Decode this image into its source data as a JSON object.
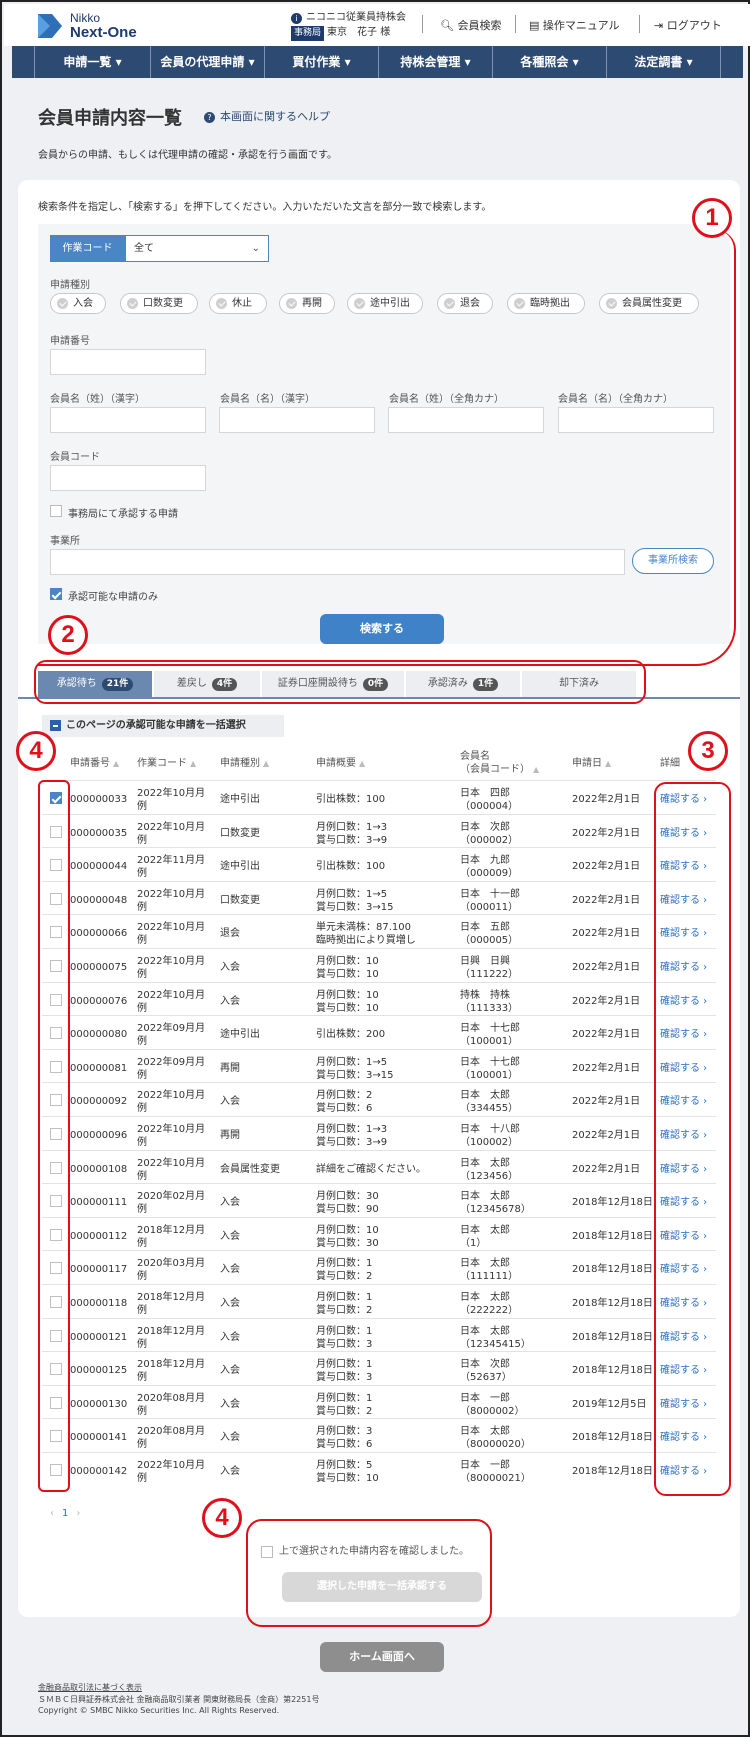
{
  "header": {
    "logo_line1": "Nikko",
    "logo_line2": "Next-One",
    "association": "ニコニコ従業員持株会",
    "role_badge": "事務局",
    "user_name": "東京　花子 様",
    "links": {
      "member_search": "会員検索",
      "manual": "操作マニュアル",
      "logout": "ログアウト"
    }
  },
  "nav": [
    "申請一覧 ▾",
    "会員の代理申請 ▾",
    "買付作業 ▾",
    "持株会管理 ▾",
    "各種照会 ▾",
    "法定調書 ▾"
  ],
  "page": {
    "title": "会員申請内容一覧",
    "help": "本画面に関するヘルプ",
    "description": "会員からの申請、もしくは代理申請の確認・承認を行う画面です。"
  },
  "search": {
    "instruction": "検索条件を指定し、「検索する」を押下してください。入力いただいた文言を部分一致で検索します。",
    "work_code_label": "作業コード",
    "work_code_value": "全て",
    "type_label": "申請種別",
    "types": [
      "入会",
      "口数変更",
      "休止",
      "再開",
      "途中引出",
      "退会",
      "臨時拠出",
      "会員属性変更"
    ],
    "app_no_label": "申請番号",
    "name_labels": [
      "会員名（姓）（漢字）",
      "会員名（名）（漢字）",
      "会員名（姓）（全角カナ）",
      "会員名（名）（全角カナ）"
    ],
    "member_code_label": "会員コード",
    "office_approve_label": "事務局にて承認する申請",
    "office_label": "事業所",
    "office_search_button": "事業所検索",
    "approvable_only_label": "承認可能な申請のみ",
    "search_button": "検索する"
  },
  "tabs": [
    {
      "label": "承認待ち",
      "count": "21件"
    },
    {
      "label": "差戻し",
      "count": "4件"
    },
    {
      "label": "証券口座開設待ち",
      "count": "0件"
    },
    {
      "label": "承認済み",
      "count": "1件"
    },
    {
      "label": "却下済み",
      "count": ""
    }
  ],
  "select_all": "このページの承認可能な申請を一括選択",
  "table": {
    "headers": [
      "申請番号",
      "作業コード",
      "申請種別",
      "申請概要",
      "会員名",
      "（会員コード）",
      "申請日",
      "詳細"
    ],
    "detail_link": "確認する ›",
    "rows": [
      {
        "no": "000000033",
        "code1": "2022年10月月",
        "code2": "例",
        "type": "途中引出",
        "sum1": "引出株数：100",
        "sum2": "",
        "name": "日本　四郎",
        "mcode": "（000004）",
        "date": "2022年2月1日",
        "checked": true
      },
      {
        "no": "000000035",
        "code1": "2022年10月月",
        "code2": "例",
        "type": "口数変更",
        "sum1": "月例口数：1→3",
        "sum2": "賞与口数：3→9",
        "name": "日本　次郎",
        "mcode": "（000002）",
        "date": "2022年2月1日",
        "checked": false
      },
      {
        "no": "000000044",
        "code1": "2022年11月月",
        "code2": "例",
        "type": "途中引出",
        "sum1": "引出株数：100",
        "sum2": "",
        "name": "日本　九郎",
        "mcode": "（000009）",
        "date": "2022年2月1日",
        "checked": false
      },
      {
        "no": "000000048",
        "code1": "2022年10月月",
        "code2": "例",
        "type": "口数変更",
        "sum1": "月例口数：1→5",
        "sum2": "賞与口数：3→15",
        "name": "日本　十一郎",
        "mcode": "（000011）",
        "date": "2022年2月1日",
        "checked": false
      },
      {
        "no": "000000066",
        "code1": "2022年10月月",
        "code2": "例",
        "type": "退会",
        "sum1": "単元未満株：87.100",
        "sum2": "臨時拠出により買増し",
        "name": "日本　五郎",
        "mcode": "（000005）",
        "date": "2022年2月1日",
        "checked": false
      },
      {
        "no": "000000075",
        "code1": "2022年10月月",
        "code2": "例",
        "type": "入会",
        "sum1": "月例口数：10",
        "sum2": "賞与口数：10",
        "name": "日興　日興",
        "mcode": "（111222）",
        "date": "2022年2月1日",
        "checked": false
      },
      {
        "no": "000000076",
        "code1": "2022年10月月",
        "code2": "例",
        "type": "入会",
        "sum1": "月例口数：10",
        "sum2": "賞与口数：10",
        "name": "持株　持株",
        "mcode": "（111333）",
        "date": "2022年2月1日",
        "checked": false
      },
      {
        "no": "000000080",
        "code1": "2022年09月月",
        "code2": "例",
        "type": "途中引出",
        "sum1": "引出株数：200",
        "sum2": "",
        "name": "日本　十七郎",
        "mcode": "（100001）",
        "date": "2022年2月1日",
        "checked": false
      },
      {
        "no": "000000081",
        "code1": "2022年09月月",
        "code2": "例",
        "type": "再開",
        "sum1": "月例口数：1→5",
        "sum2": "賞与口数：3→15",
        "name": "日本　十七郎",
        "mcode": "（100001）",
        "date": "2022年2月1日",
        "checked": false
      },
      {
        "no": "000000092",
        "code1": "2022年10月月",
        "code2": "例",
        "type": "入会",
        "sum1": "月例口数：2",
        "sum2": "賞与口数：6",
        "name": "日本　太郎",
        "mcode": "（334455）",
        "date": "2022年2月1日",
        "checked": false
      },
      {
        "no": "000000096",
        "code1": "2022年10月月",
        "code2": "例",
        "type": "再開",
        "sum1": "月例口数：1→3",
        "sum2": "賞与口数：3→9",
        "name": "日本　十八郎",
        "mcode": "（100002）",
        "date": "2022年2月1日",
        "checked": false
      },
      {
        "no": "000000108",
        "code1": "2022年10月月",
        "code2": "例",
        "type": "会員属性変更",
        "sum1": "詳細をご確認ください。",
        "sum2": "",
        "name": "日本　太郎",
        "mcode": "（123456）",
        "date": "2022年2月1日",
        "checked": false
      },
      {
        "no": "000000111",
        "code1": "2020年02月月",
        "code2": "例",
        "type": "入会",
        "sum1": "月例口数：30",
        "sum2": "賞与口数：90",
        "name": "日本　太郎",
        "mcode": "（12345678）",
        "date": "2018年12月18日",
        "checked": false
      },
      {
        "no": "000000112",
        "code1": "2018年12月月",
        "code2": "例",
        "type": "入会",
        "sum1": "月例口数：10",
        "sum2": "賞与口数：30",
        "name": "日本　太郎",
        "mcode": "（1）",
        "date": "2018年12月18日",
        "checked": false
      },
      {
        "no": "000000117",
        "code1": "2020年03月月",
        "code2": "例",
        "type": "入会",
        "sum1": "月例口数：1",
        "sum2": "賞与口数：2",
        "name": "日本　太郎",
        "mcode": "（111111）",
        "date": "2018年12月18日",
        "checked": false
      },
      {
        "no": "000000118",
        "code1": "2018年12月月",
        "code2": "例",
        "type": "入会",
        "sum1": "月例口数：1",
        "sum2": "賞与口数：2",
        "name": "日本　太郎",
        "mcode": "（222222）",
        "date": "2018年12月18日",
        "checked": false
      },
      {
        "no": "000000121",
        "code1": "2018年12月月",
        "code2": "例",
        "type": "入会",
        "sum1": "月例口数：1",
        "sum2": "賞与口数：3",
        "name": "日本　太郎",
        "mcode": "（12345415）",
        "date": "2018年12月18日",
        "checked": false
      },
      {
        "no": "000000125",
        "code1": "2018年12月月",
        "code2": "例",
        "type": "入会",
        "sum1": "月例口数：1",
        "sum2": "賞与口数：3",
        "name": "日本　次郎",
        "mcode": "（52637）",
        "date": "2018年12月18日",
        "checked": false
      },
      {
        "no": "000000130",
        "code1": "2020年08月月",
        "code2": "例",
        "type": "入会",
        "sum1": "月例口数：1",
        "sum2": "賞与口数：2",
        "name": "日本　一郎",
        "mcode": "（8000002）",
        "date": "2019年12月5日",
        "checked": false
      },
      {
        "no": "000000141",
        "code1": "2020年08月月",
        "code2": "例",
        "type": "入会",
        "sum1": "月例口数：3",
        "sum2": "賞与口数：6",
        "name": "日本　太郎",
        "mcode": "（80000020）",
        "date": "2018年12月18日",
        "checked": false
      },
      {
        "no": "000000142",
        "code1": "2022年10月月",
        "code2": "例",
        "type": "入会",
        "sum1": "月例口数：5",
        "sum2": "賞与口数：10",
        "name": "日本　一郎",
        "mcode": "（80000021）",
        "date": "2018年12月18日",
        "checked": false
      }
    ]
  },
  "pager": {
    "prev": "‹",
    "page": "1",
    "next": "›"
  },
  "bulk": {
    "confirm_label": "上で選択された申請内容を確認しました。",
    "approve_button": "選択した申請を一括承認する"
  },
  "home_button": "ホーム画面へ",
  "footer": {
    "link": "金融商品取引法に基づく表示",
    "line2": "ＳＭＢＣ日興証券株式会社 金融商品取引業者 関東財務局長（金商）第2251号",
    "copyright": "Copyright © SMBC Nikko Securities Inc. All Rights Reserved."
  },
  "annotations": [
    "1",
    "2",
    "3",
    "4",
    "4"
  ],
  "colors": {
    "nav": "#2d4a72",
    "accent": "#3f82c8",
    "annotation": "#e0101a"
  }
}
